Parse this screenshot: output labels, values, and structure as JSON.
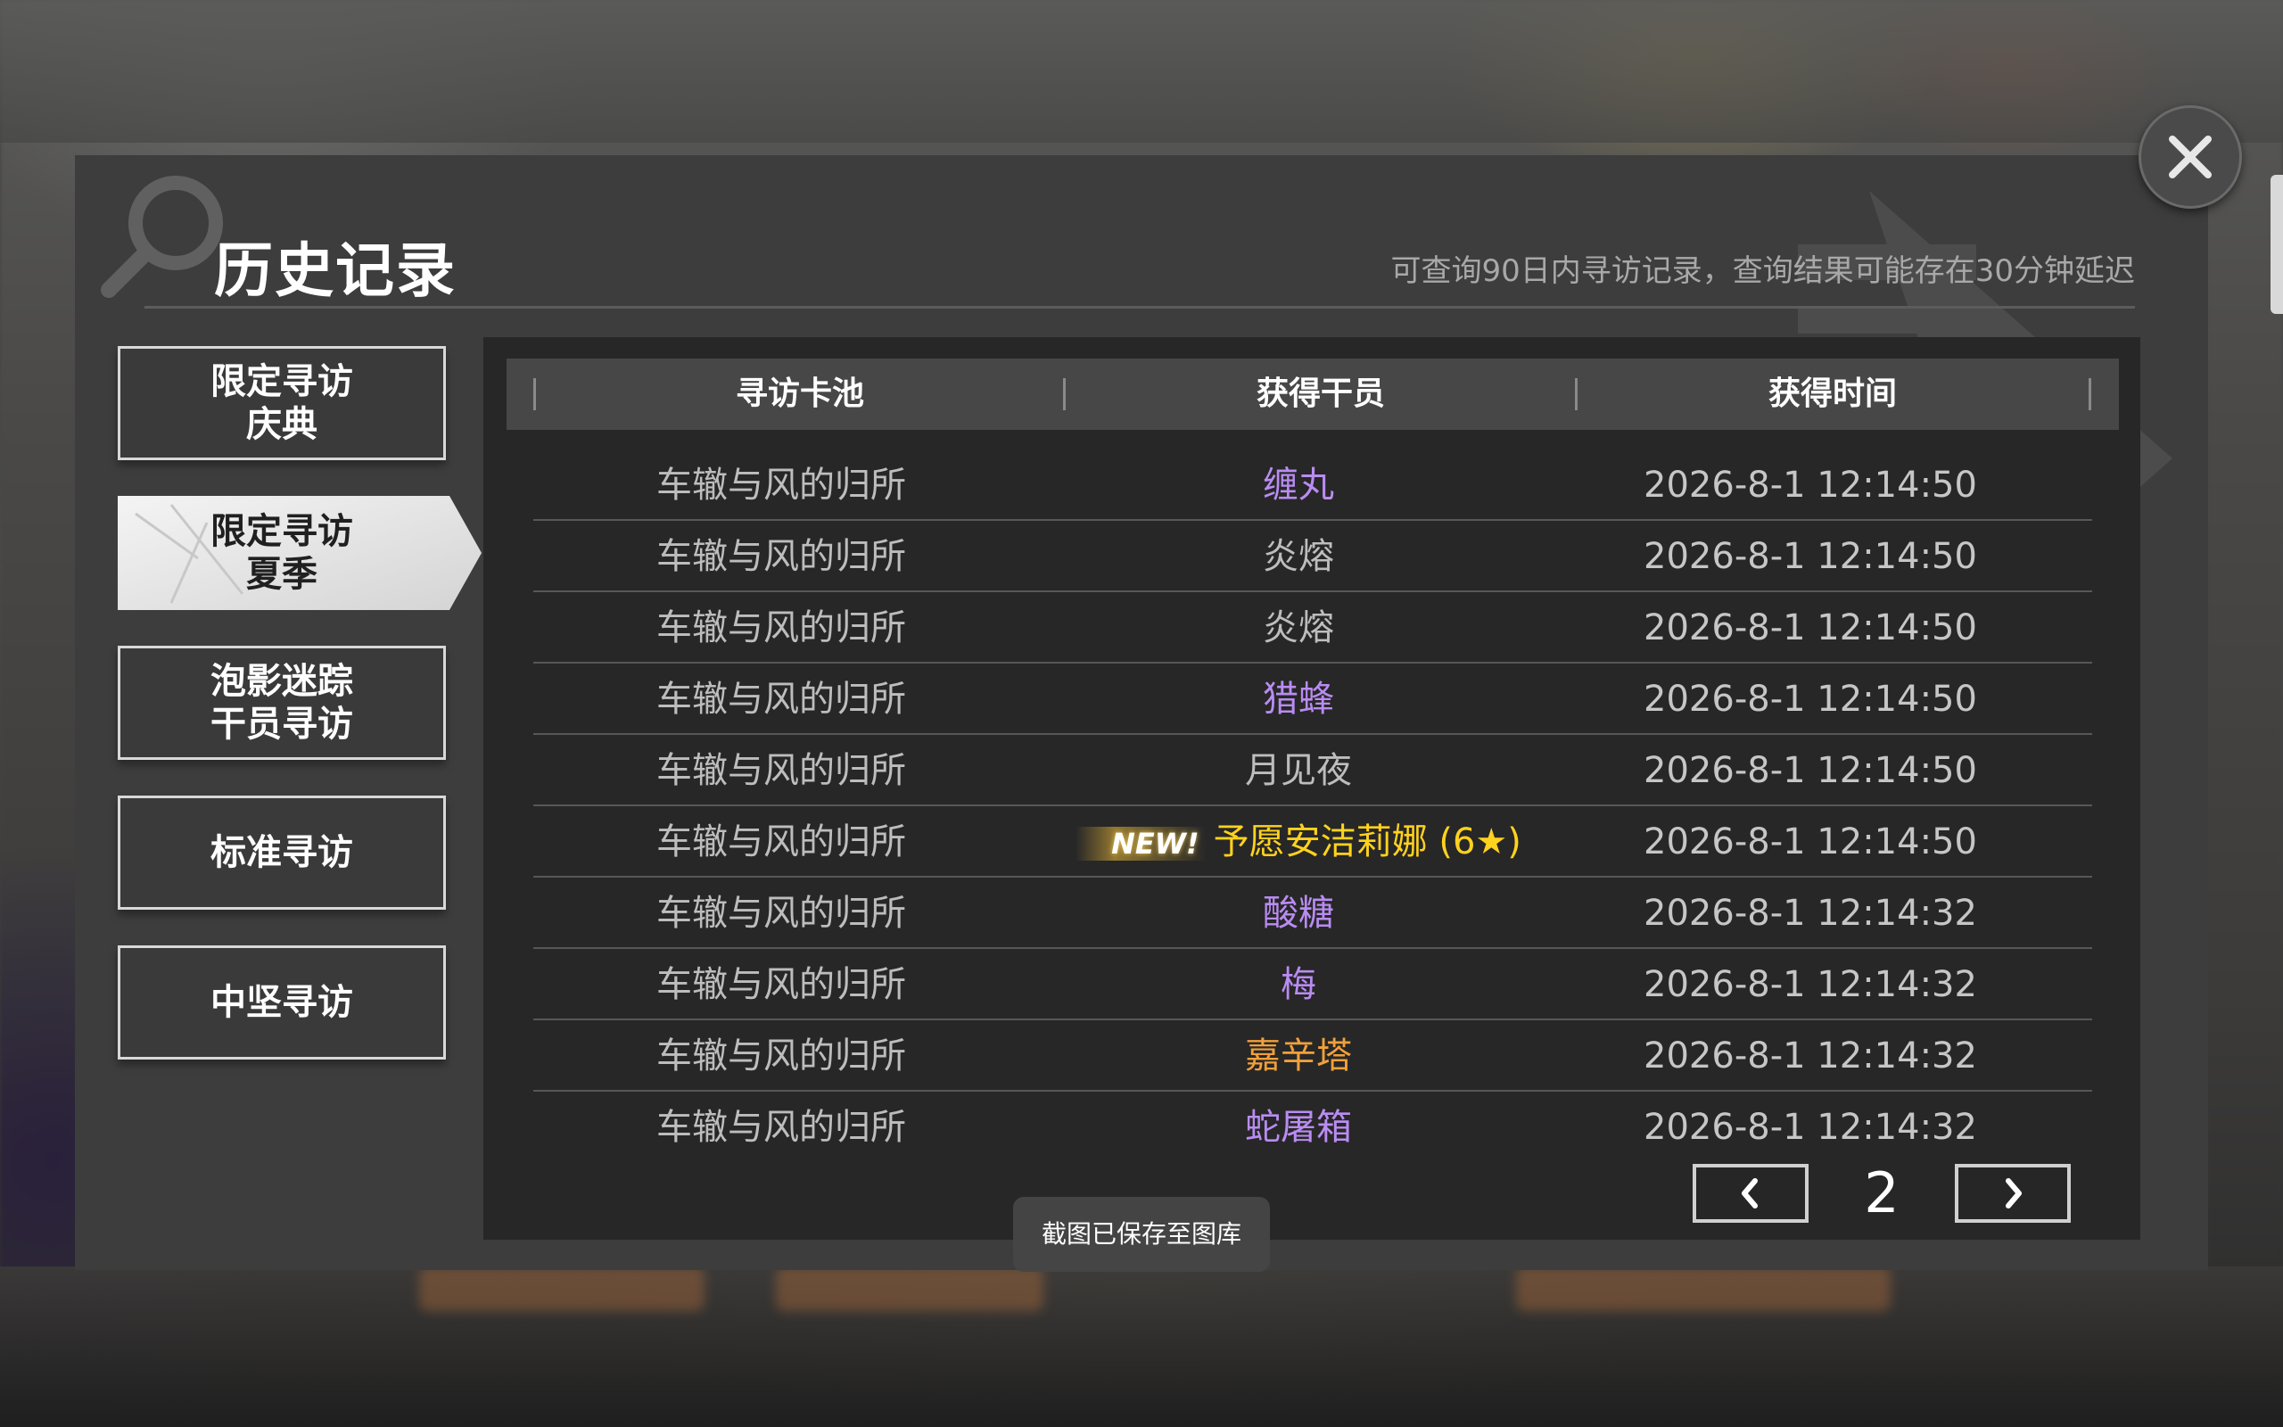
{
  "header": {
    "title": "历史记录",
    "subtitle": "可查询90日内寻访记录，查询结果可能存在30分钟延迟"
  },
  "sidebar": {
    "items": [
      {
        "label": "限定寻访\n庆典",
        "active": false
      },
      {
        "label": "限定寻访\n夏季",
        "active": true
      },
      {
        "label": "泡影迷踪\n干员寻访",
        "active": false
      },
      {
        "label": "标准寻访",
        "active": false
      },
      {
        "label": "中坚寻访",
        "active": false
      }
    ]
  },
  "table": {
    "columns": [
      "寻访卡池",
      "获得干员",
      "获得时间"
    ],
    "rows": [
      {
        "pool": "车辙与风的归所",
        "operator": "缠丸",
        "time": "2026-8-1 12:14:50",
        "color": "#b98cf2"
      },
      {
        "pool": "车辙与风的归所",
        "operator": "炎熔",
        "time": "2026-8-1 12:14:50",
        "color": "#bdbdbd"
      },
      {
        "pool": "车辙与风的归所",
        "operator": "炎熔",
        "time": "2026-8-1 12:14:50",
        "color": "#bdbdbd"
      },
      {
        "pool": "车辙与风的归所",
        "operator": "猎蜂",
        "time": "2026-8-1 12:14:50",
        "color": "#b98cf2"
      },
      {
        "pool": "车辙与风的归所",
        "operator": "月见夜",
        "time": "2026-8-1 12:14:50",
        "color": "#bdbdbd"
      },
      {
        "pool": "车辙与风的归所",
        "operator": "予愿安洁莉娜 (6★)",
        "time": "2026-8-1 12:14:50",
        "color": "#ffd21e",
        "new_label": "NEW!"
      },
      {
        "pool": "车辙与风的归所",
        "operator": "酸糖",
        "time": "2026-8-1 12:14:32",
        "color": "#b98cf2"
      },
      {
        "pool": "车辙与风的归所",
        "operator": "梅",
        "time": "2026-8-1 12:14:32",
        "color": "#b98cf2"
      },
      {
        "pool": "车辙与风的归所",
        "operator": "嘉辛塔",
        "time": "2026-8-1 12:14:32",
        "color": "#f0a03c"
      },
      {
        "pool": "车辙与风的归所",
        "operator": "蛇屠箱",
        "time": "2026-8-1 12:14:32",
        "color": "#b98cf2"
      }
    ]
  },
  "pagination": {
    "current_page": "2",
    "prev_icon": "chevron-left-icon",
    "next_icon": "chevron-right-icon"
  },
  "toast": {
    "text": "截图已保存至图库"
  },
  "colors": {
    "panel_bg": "#3d3d3d",
    "table_bg": "#272727",
    "header_bg": "#474747",
    "rarity_4": "#b98cf2",
    "rarity_5": "#f0a03c",
    "rarity_6": "#ffd21e",
    "rarity_3": "#bdbdbd"
  }
}
